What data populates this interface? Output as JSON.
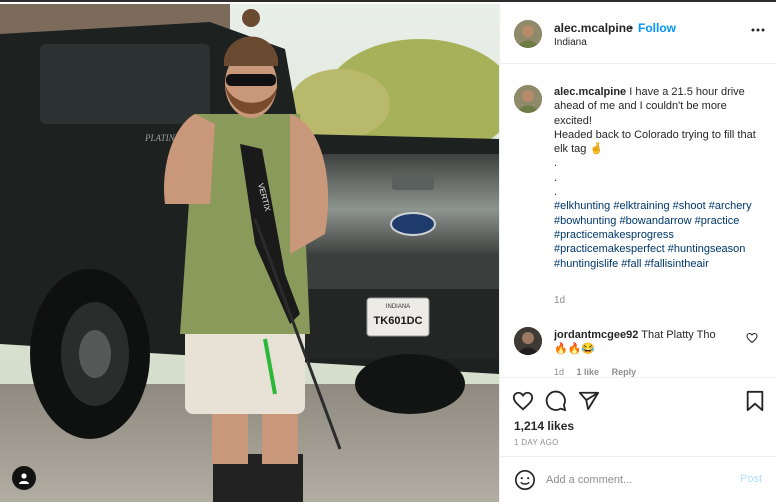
{
  "post": {
    "username": "alec.mcalpine",
    "dot": "•",
    "follow_label": "Follow",
    "location": "Indiana",
    "more_icon": "more-horizontal-icon",
    "photo": {
      "description_icon": "tagged-user-icon",
      "plate_state": "INDIANA",
      "plate_number": "TK601DC",
      "truck_badge": "PLATINUM",
      "bow_brand": "VERTIX"
    }
  },
  "caption": {
    "username": "alec.mcalpine",
    "line1": "I have a 21.5 hour drive ahead of me and I couldn't be more excited!",
    "line2": "Headed back to Colorado trying to fill that elk tag 🤞",
    "dots": [
      ".",
      ".",
      "."
    ],
    "hashtags": [
      "#elkhunting",
      "#elktraining",
      "#shoot",
      "#archery",
      "#bowhunting",
      "#bowandarrow",
      "#practice",
      "#practicemakesprogress",
      "#practicemakesperfect",
      "#huntingseason",
      "#huntingislife",
      "#fall",
      "#fallisintheair"
    ],
    "time": "1d"
  },
  "comment": {
    "username": "jordantmcgee92",
    "text": "That Platty Tho",
    "emojis": "🔥🔥😂",
    "time": "1d",
    "likes": "1 like",
    "reply": "Reply"
  },
  "actions": {
    "likes": "1,214 likes",
    "ago": "1 DAY AGO"
  },
  "add_comment": {
    "placeholder": "Add a comment...",
    "post_label": "Post"
  },
  "colors": {
    "accent": "#0095f6",
    "hashtag": "#00376b",
    "muted": "#8e8e8e",
    "post_disabled": "#b2dffc"
  }
}
